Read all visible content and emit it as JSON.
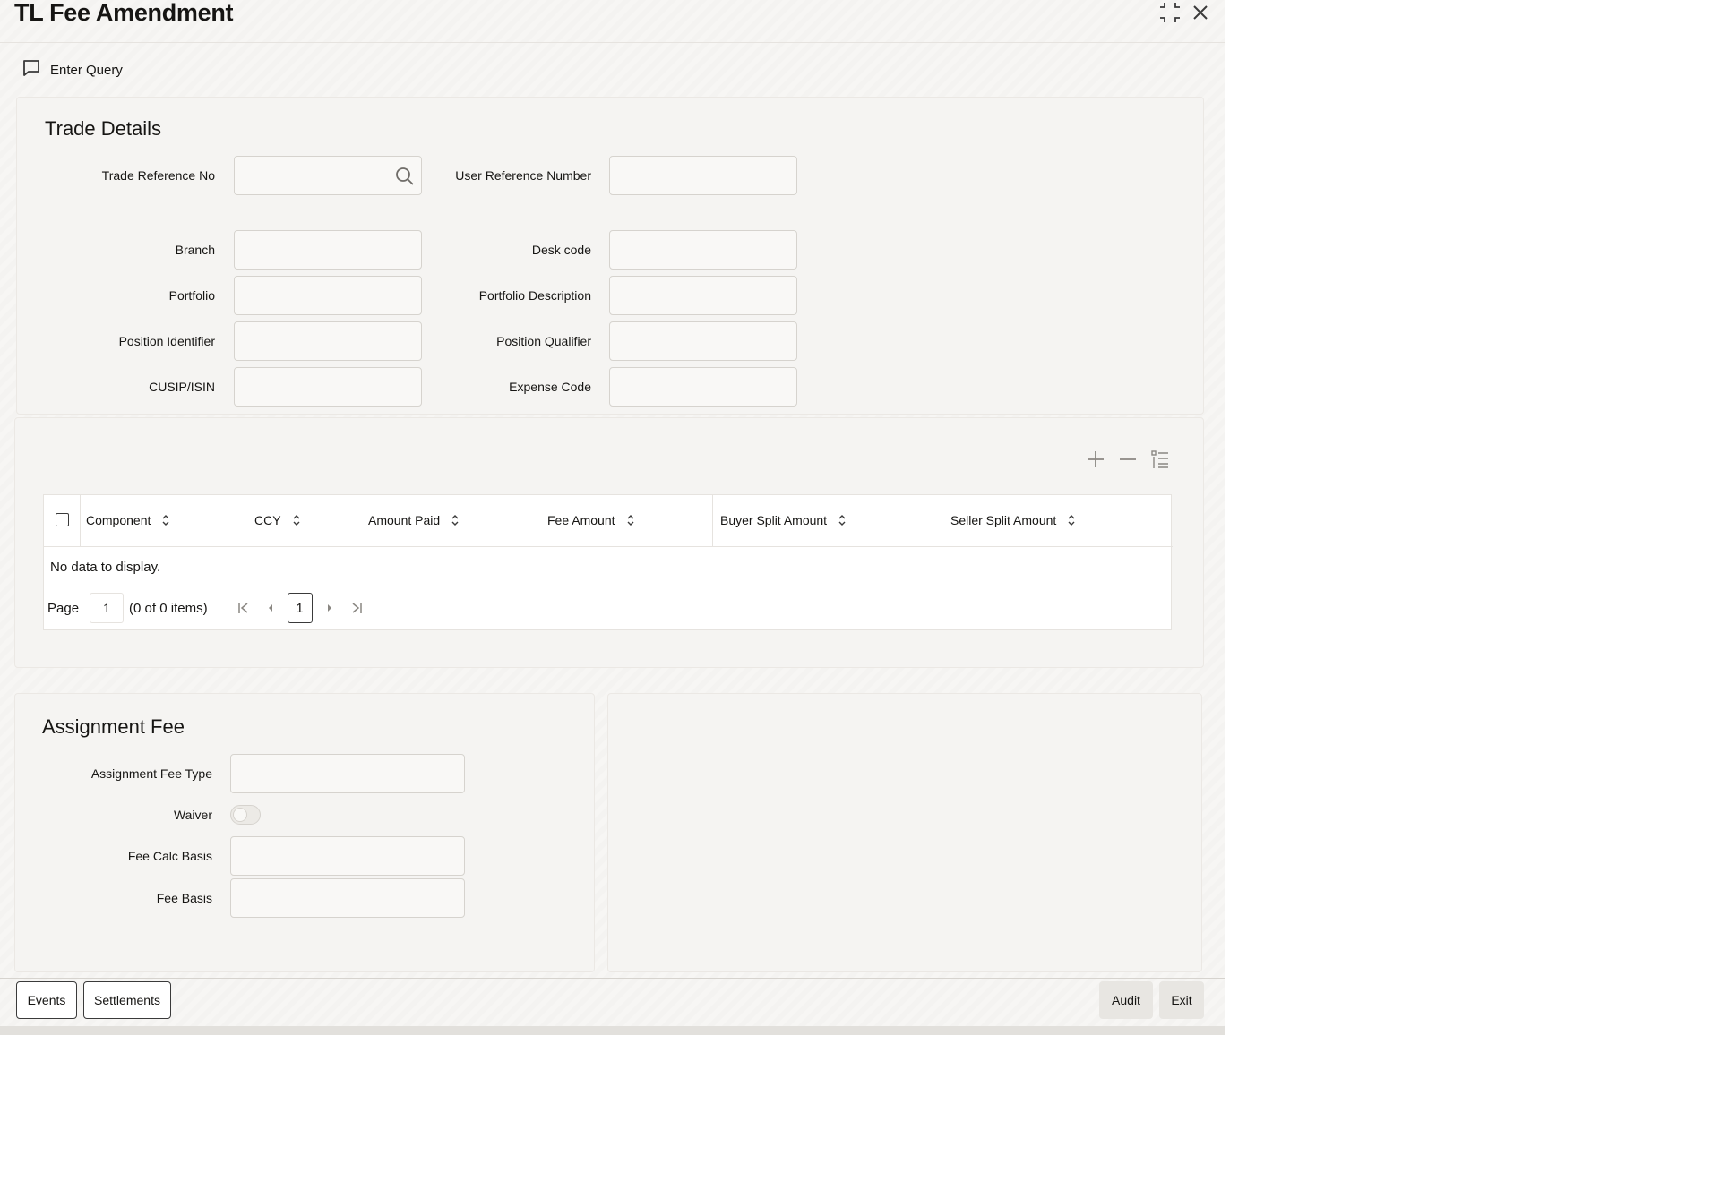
{
  "window": {
    "title": "TL Fee Amendment"
  },
  "toolbar": {
    "enter_query_label": "Enter Query"
  },
  "trade_details": {
    "section_title": "Trade Details",
    "labels": {
      "trade_reference_no": "Trade Reference No",
      "user_reference_number": "User Reference Number",
      "branch": "Branch",
      "desk_code": "Desk code",
      "portfolio": "Portfolio",
      "portfolio_description": "Portfolio Description",
      "position_identifier": "Position Identifier",
      "position_qualifier": "Position Qualifier",
      "cusip_isin": "CUSIP/ISIN",
      "expense_code": "Expense Code"
    },
    "values": {
      "trade_reference_no": "",
      "user_reference_number": "",
      "branch": "",
      "desk_code": "",
      "portfolio": "",
      "portfolio_description": "",
      "position_identifier": "",
      "position_qualifier": "",
      "cusip_isin": "",
      "expense_code": ""
    }
  },
  "fee_grid": {
    "columns": [
      "Component",
      "CCY",
      "Amount Paid",
      "Fee Amount",
      "Buyer Split Amount",
      "Seller Split Amount"
    ],
    "empty_message": "No data to display.",
    "pager": {
      "page_label": "Page",
      "page_value": "1",
      "items_summary": "(0 of 0 items)",
      "current_page": "1"
    }
  },
  "assignment_fee": {
    "section_title": "Assignment Fee",
    "labels": {
      "assignment_fee_type": "Assignment Fee Type",
      "waiver": "Waiver",
      "fee_calc_basis": "Fee Calc Basis",
      "fee_basis": "Fee Basis"
    },
    "values": {
      "assignment_fee_type": "",
      "waiver": false,
      "fee_calc_basis": "",
      "fee_basis": ""
    }
  },
  "footer": {
    "events_label": "Events",
    "settlements_label": "Settlements",
    "audit_label": "Audit",
    "exit_label": "Exit"
  }
}
